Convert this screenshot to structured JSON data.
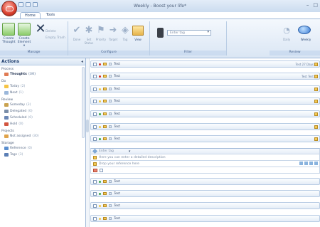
{
  "window": {
    "title": "Weekly - Boost your life*",
    "controls": [
      "–",
      "□"
    ]
  },
  "tabs": [
    {
      "label": "Home",
      "active": true
    },
    {
      "label": "Tools",
      "active": false
    }
  ],
  "ribbon": {
    "manage": {
      "label": "Manage",
      "create_thought": "Create Thought",
      "create_element": "Create Element ▾",
      "delete": "Delete",
      "empty_trash": "Empty Trash"
    },
    "configure": {
      "label": "Configure",
      "buttons": [
        "Done",
        "Set Status",
        "Priority",
        "Target",
        "Tag",
        "View"
      ]
    },
    "filter": {
      "label": "Filter",
      "placeholder": "Enter tag"
    },
    "review": {
      "label": "Review",
      "buttons": [
        "Daily",
        "Weekly"
      ]
    }
  },
  "sidebar": {
    "header": "Actions",
    "sections": [
      {
        "title": "Process",
        "items": [
          {
            "label": "Thoughts",
            "count": "(30)",
            "selected": true,
            "color": "#e07b54"
          }
        ]
      },
      {
        "title": "Do",
        "items": [
          {
            "label": "Today",
            "count": "(2)",
            "color": "#f6c445"
          },
          {
            "label": "Next",
            "count": "(1)",
            "color": "#9bb7da"
          }
        ]
      },
      {
        "title": "Review",
        "items": [
          {
            "label": "Someday",
            "count": "(3)",
            "color": "#c9a24f"
          },
          {
            "label": "Delegated",
            "count": "(0)",
            "color": "#7a8da8"
          },
          {
            "label": "Scheduled",
            "count": "(0)",
            "color": "#6b87b5"
          },
          {
            "label": "Hold",
            "count": "(0)",
            "color": "#d2553f"
          }
        ]
      },
      {
        "title": "Projects",
        "items": [
          {
            "label": "Not assigned",
            "count": "(30)",
            "color": "#e0a34a"
          }
        ]
      },
      {
        "title": "Storage",
        "items": [
          {
            "label": "Reference",
            "count": "(0)",
            "color": "#5b8fcf"
          },
          {
            "label": "Tags",
            "count": "(3)",
            "color": "#5b7fb5"
          }
        ]
      }
    ]
  },
  "rows": [
    {
      "text": "Test",
      "dot": "#d9322b",
      "right": "Test 27 Days"
    },
    {
      "text": "Test",
      "dot": "#d9322b",
      "right": "Test Test"
    },
    {
      "text": "Test",
      "dot": "#f2c94c",
      "right": ""
    },
    {
      "text": "Test",
      "dot": "#f2c94c",
      "right": ""
    },
    {
      "text": "Test",
      "dot": "#3aa845",
      "right": ""
    },
    {
      "text": "Test",
      "dot": "#3aa845",
      "right": ""
    },
    {
      "text": "Test",
      "dot": "#f2c94c",
      "right": ""
    }
  ],
  "editor": {
    "tag_placeholder": "Enter tag",
    "description": "Here you can enter a detailed description",
    "reference": "Drop your reference here"
  }
}
